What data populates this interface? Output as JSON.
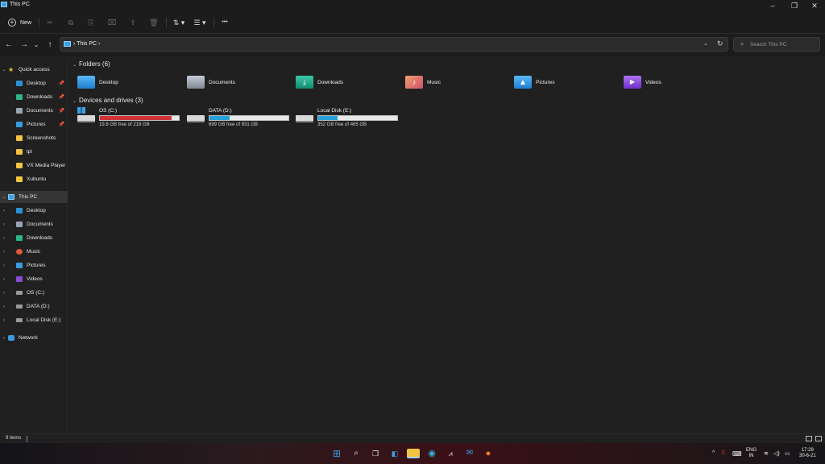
{
  "window": {
    "title": "This PC",
    "accent": "#3aa0e8"
  },
  "caption_buttons": {
    "minimize": "–",
    "maximize": "❐",
    "close": "✕"
  },
  "toolbar": {
    "new_label": "New",
    "cut_icon": "✂",
    "copy_icon": "⧉",
    "paste_icon": "⎘",
    "rename_icon": "⌧",
    "share_icon": "⇪",
    "delete_icon": "🗑",
    "sort_icon": "⇅ ▾",
    "view_icon": "☰ ▾",
    "more_icon": "•••"
  },
  "nav": {
    "back": "←",
    "forward": "→",
    "recent": "⌄",
    "up": "↑"
  },
  "address": {
    "path": "›  This PC  ›",
    "dropdown": "⌄",
    "refresh": "↻"
  },
  "search": {
    "icon": "⌕",
    "placeholder": "Search This PC"
  },
  "sidebar": {
    "quick_access": {
      "label": "Quick access",
      "items": [
        {
          "label": "Desktop",
          "color": "#2d8fd6",
          "pinned": true
        },
        {
          "label": "Downloads",
          "color": "#2fb58a",
          "pinned": true
        },
        {
          "label": "Documents",
          "color": "#9aa4b0",
          "pinned": true
        },
        {
          "label": "Pictures",
          "color": "#3a9be0",
          "pinned": true
        },
        {
          "label": "Screenshots",
          "color": "#f2c441",
          "pinned": false
        },
        {
          "label": "tpl",
          "color": "#f2c441",
          "pinned": false
        },
        {
          "label": "VX Media Player",
          "color": "#f2c441",
          "pinned": false
        },
        {
          "label": "Xubuntu",
          "color": "#f2c441",
          "pinned": false
        }
      ],
      "pin_icon": "📌"
    },
    "this_pc": {
      "label": "This PC",
      "items": [
        {
          "label": "Desktop",
          "color": "#2d8fd6"
        },
        {
          "label": "Documents",
          "color": "#9aa4b0"
        },
        {
          "label": "Downloads",
          "color": "#2fb58a"
        },
        {
          "label": "Music",
          "color": "#e0573a"
        },
        {
          "label": "Pictures",
          "color": "#3a9be0"
        },
        {
          "label": "Videos",
          "color": "#8a4ad8"
        },
        {
          "label": "OS (C:)",
          "color": "#9a9a9a"
        },
        {
          "label": "DATA (D:)",
          "color": "#9a9a9a"
        },
        {
          "label": "Local Disk (E:)",
          "color": "#9a9a9a"
        }
      ]
    },
    "network": {
      "label": "Network"
    }
  },
  "folders_section": {
    "title": "Folders (6)"
  },
  "folders": [
    {
      "label": "Desktop",
      "color": "#2d8fd6"
    },
    {
      "label": "Documents",
      "color": "#9aa4b0"
    },
    {
      "label": "Downloads",
      "color": "#20a88a"
    },
    {
      "label": "Music",
      "color": "#e07a5a"
    },
    {
      "label": "Pictures",
      "color": "#3a9be0"
    },
    {
      "label": "Videos",
      "color": "#8a4ad8"
    }
  ],
  "drives_section": {
    "title": "Devices and drives (3)"
  },
  "drives": [
    {
      "name": "OS (C:)",
      "free": "19.8 GB free of 219 GB",
      "used_fraction": 0.91,
      "bar_color": "#d13438"
    },
    {
      "name": "DATA (D:)",
      "free": "699 GB free of 931 GB",
      "used_fraction": 0.25,
      "bar_color": "#26a0da"
    },
    {
      "name": "Local Disk (E:)",
      "free": "352 GB free of 465 GB",
      "used_fraction": 0.24,
      "bar_color": "#26a0da"
    }
  ],
  "status": {
    "items": "9 items"
  },
  "taskbar": {
    "apps": [
      "start",
      "search",
      "task-view",
      "widgets",
      "file-explorer",
      "edge",
      "terminal",
      "mail",
      "firefox"
    ],
    "tray": {
      "chevron": "^",
      "lang_top": "ENG",
      "lang_bottom": "IN",
      "time": "17:29",
      "date": "30-6-21"
    }
  }
}
